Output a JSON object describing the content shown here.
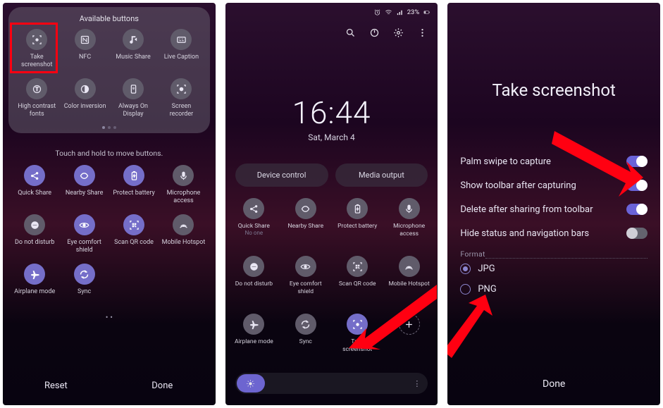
{
  "screen1": {
    "panel_title": "Available buttons",
    "instruction": "Touch and hold to move buttons.",
    "available": [
      {
        "icon": "screenshot",
        "label": "Take screenshot"
      },
      {
        "icon": "nfc",
        "label": "NFC"
      },
      {
        "icon": "music",
        "label": "Music Share"
      },
      {
        "icon": "caption",
        "label": "Live Caption"
      },
      {
        "icon": "contrast",
        "label": "High contrast fonts"
      },
      {
        "icon": "invert",
        "label": "Color inversion"
      },
      {
        "icon": "aod",
        "label": "Always On Display"
      },
      {
        "icon": "record",
        "label": "Screen recorder"
      }
    ],
    "active": [
      {
        "icon": "share",
        "label": "Quick Share",
        "active": true
      },
      {
        "icon": "nearby",
        "label": "Nearby Share",
        "active": true
      },
      {
        "icon": "battery",
        "label": "Protect battery",
        "active": true
      },
      {
        "icon": "mic",
        "label": "Microphone access"
      },
      {
        "icon": "dnd",
        "label": "Do not disturb"
      },
      {
        "icon": "eye",
        "label": "Eye comfort shield",
        "active": true
      },
      {
        "icon": "qr",
        "label": "Scan QR code",
        "active": true
      },
      {
        "icon": "hotspot",
        "label": "Mobile Hotspot"
      },
      {
        "icon": "plane",
        "label": "Airplane mode",
        "active": true
      },
      {
        "icon": "sync",
        "label": "Sync",
        "active": true
      }
    ],
    "reset": "Reset",
    "done": "Done"
  },
  "screen2": {
    "status": {
      "battery": "23%"
    },
    "clock": "16:44",
    "date": "Sat, March 4",
    "device_control": "Device control",
    "media_output": "Media output",
    "tiles": [
      {
        "icon": "share",
        "label": "Quick Share",
        "sub": "No one"
      },
      {
        "icon": "nearby",
        "label": "Nearby Share"
      },
      {
        "icon": "battery",
        "label": "Protect battery"
      },
      {
        "icon": "mic",
        "label": "Microphone access"
      },
      {
        "icon": "dnd",
        "label": "Do not disturb"
      },
      {
        "icon": "eye",
        "label": "Eye comfort shield"
      },
      {
        "icon": "qr",
        "label": "Scan QR code"
      },
      {
        "icon": "hotspot",
        "label": "Mobile Hotspot"
      },
      {
        "icon": "plane",
        "label": "Airplane mode"
      },
      {
        "icon": "sync",
        "label": "Sync"
      },
      {
        "icon": "screenshot",
        "label": "Take screenshot",
        "active": true
      },
      {
        "icon": "plus",
        "label": ""
      }
    ]
  },
  "screen3": {
    "title": "Take screenshot",
    "options": [
      {
        "label": "Palm swipe to capture",
        "on": true
      },
      {
        "label": "Show toolbar after capturing",
        "on": true
      },
      {
        "label": "Delete after sharing from toolbar",
        "on": true
      },
      {
        "label": "Hide status and navigation bars",
        "on": false
      }
    ],
    "format_label": "Format",
    "formats": [
      {
        "label": "JPG",
        "on": true
      },
      {
        "label": "PNG",
        "on": false
      }
    ],
    "done": "Done"
  }
}
